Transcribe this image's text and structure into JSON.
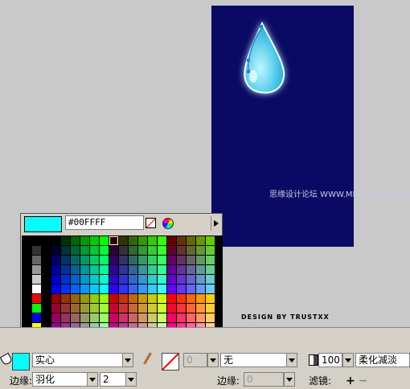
{
  "stage": {
    "watermark": "思缘设计论坛 WWW.MISSYUAN.COM",
    "credit": "DESIGN BY TRUSTXX",
    "colors": {
      "background": "#0a0a64",
      "drop_light": "#bff6ff",
      "drop_mid": "#5fd0ee",
      "drop_dark": "#1aa6d8"
    }
  },
  "palette": {
    "selected_color": "#00FFFF",
    "hex_value": "#00FFFF",
    "no_color_icon": "no-color-icon",
    "color_wheel_icon": "color-wheel-icon",
    "expand_icon": "expand-arrow-icon"
  },
  "panel": {
    "fill_color": "#00FFFF",
    "fill_style": "实心",
    "stroke_style": "无",
    "stroke_width": "0",
    "alpha": "100",
    "blend_mode": "柔化减淡",
    "edge_label": "边缘:",
    "edge_value": "羽化",
    "edge_amount": "2",
    "edge_label_2": "边缘:",
    "edge_value_2": "0",
    "filter_label": "滤镜:",
    "filter_add": "+",
    "filter_remove": "−"
  }
}
